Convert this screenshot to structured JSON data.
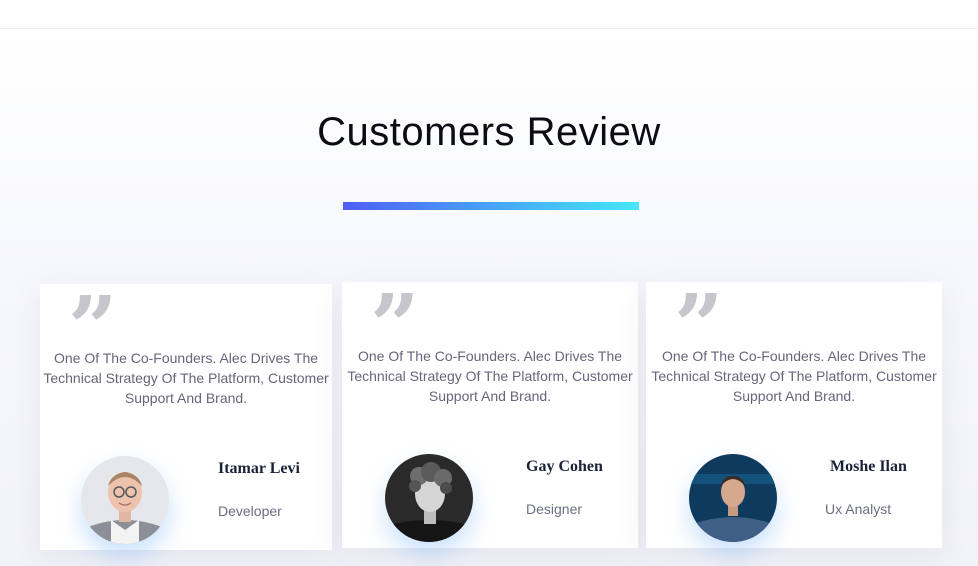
{
  "section": {
    "title": "Customers Review"
  },
  "reviews": [
    {
      "quote": "One Of The Co-Founders. Alec Drives The Technical Strategy Of The Platform, Customer Support And Brand.",
      "name": "Itamar Levi",
      "role": "Developer"
    },
    {
      "quote": "One Of The Co-Founders. Alec Drives The Technical Strategy Of The Platform, Customer Support And Brand.",
      "name": "Gay Cohen",
      "role": "Designer"
    },
    {
      "quote": "One Of The Co-Founders. Alec Drives The Technical Strategy Of The Platform, Customer Support And Brand.",
      "name": "Moshe Ilan",
      "role": "Ux Analyst"
    }
  ],
  "icons": {
    "quote": "quote-icon",
    "avatar": "avatar-photo"
  },
  "colors": {
    "divider_start": "#4f5ff5",
    "divider_end": "#45e7fb",
    "quote_icon": "#c6c7cc",
    "name": "#1a2238"
  }
}
